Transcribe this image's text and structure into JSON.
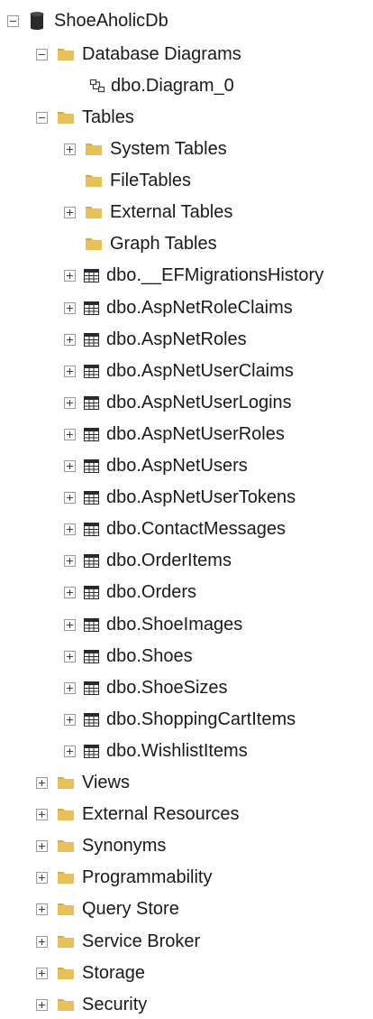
{
  "tree": {
    "root": {
      "label": "ShoeAholicDb",
      "icon": "database-icon",
      "expanded": true
    },
    "database_diagrams": {
      "label": "Database Diagrams",
      "expanded": true
    },
    "diagram_0": {
      "label": "dbo.Diagram_0",
      "icon": "diagram-icon"
    },
    "tables": {
      "label": "Tables",
      "expanded": true
    },
    "table_folders": [
      {
        "label": "System Tables",
        "expandable": true
      },
      {
        "label": "FileTables",
        "expandable": false
      },
      {
        "label": "External Tables",
        "expandable": true
      },
      {
        "label": "Graph Tables",
        "expandable": false
      }
    ],
    "table_items": [
      {
        "label": "dbo.__EFMigrationsHistory"
      },
      {
        "label": "dbo.AspNetRoleClaims"
      },
      {
        "label": "dbo.AspNetRoles"
      },
      {
        "label": "dbo.AspNetUserClaims"
      },
      {
        "label": "dbo.AspNetUserLogins"
      },
      {
        "label": "dbo.AspNetUserRoles"
      },
      {
        "label": "dbo.AspNetUsers"
      },
      {
        "label": "dbo.AspNetUserTokens"
      },
      {
        "label": "dbo.ContactMessages"
      },
      {
        "label": "dbo.OrderItems"
      },
      {
        "label": "dbo.Orders"
      },
      {
        "label": "dbo.ShoeImages"
      },
      {
        "label": "dbo.Shoes"
      },
      {
        "label": "dbo.ShoeSizes"
      },
      {
        "label": "dbo.ShoppingCartItems"
      },
      {
        "label": "dbo.WishlistItems"
      }
    ],
    "db_folders": [
      {
        "label": "Views"
      },
      {
        "label": "External Resources"
      },
      {
        "label": "Synonyms"
      },
      {
        "label": "Programmability"
      },
      {
        "label": "Query Store"
      },
      {
        "label": "Service Broker"
      },
      {
        "label": "Storage"
      },
      {
        "label": "Security"
      }
    ]
  },
  "colors": {
    "folder": "#e8c05a",
    "folder_tab": "#d9ab3c",
    "database": "#2b2b2b",
    "text": "#1a1a1a"
  }
}
